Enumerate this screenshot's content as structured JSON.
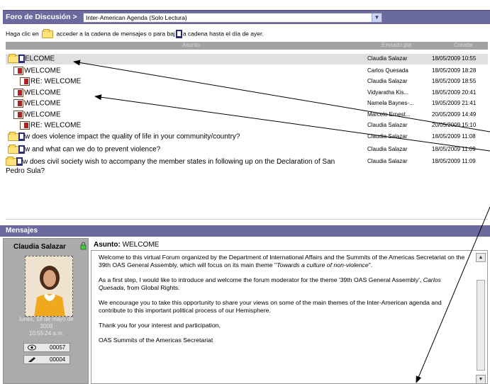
{
  "forum": {
    "title": "Foro de Discusión >",
    "selected_forum": "Inter-American Agenda (Solo Lectura)"
  },
  "instructions": {
    "part1": "Haga clic en",
    "part2": "acceder a la cadena de mensajes o para baj",
    "part3": "a cadena hasta el día de ayer."
  },
  "columns": {
    "subject": "Asunto",
    "sender": "Enviado por",
    "created": "Creada"
  },
  "threads": [
    {
      "subject": "ELCOME",
      "sender": "Claudia Salazar",
      "date": "18/05/2009 10:55"
    },
    {
      "subject": "WELCOME",
      "sender": "Carlos Quesada",
      "date": "18/05/2009 18:28"
    },
    {
      "subject": "RE: WELCOME",
      "sender": "Claudia Salazar",
      "date": "18/05/2009 18:55"
    },
    {
      "subject": "WELCOME",
      "sender": "Vidyaratha Kis...",
      "date": "18/05/2009 20:41"
    },
    {
      "subject": "WELCOME",
      "sender": "Namela Baynes-...",
      "date": "19/05/2009 21:41"
    },
    {
      "subject": "WELCOME",
      "sender": "Marcelo Ernest...",
      "date": "20/05/2009 14:49"
    },
    {
      "subject": "RE: WELCOME",
      "sender": "Claudia Salazar",
      "date": "20/05/2009 15:10"
    },
    {
      "subject": "w does violence impact the quality of life in your community/country?",
      "sender": "Claudia Salazar",
      "date": "18/05/2009 11:08"
    },
    {
      "subject": "w and what can we do to prevent violence?",
      "sender": "Claudia Salazar",
      "date": "18/05/2009 11:09"
    },
    {
      "subject": "w does civil society wish to accompany the member states in following up on the Declaration of San Pedro Sula?",
      "sender": "Claudia Salazar",
      "date": "18/05/2009 11:09"
    }
  ],
  "messages_panel": {
    "title": "Mensajes",
    "author": "Claudia Salazar",
    "author_date_line1": "lunes, 18 de mayo de",
    "author_date_line2": "2009",
    "author_time": "10:55:24 a.m.",
    "views": "00057",
    "posts": "00004",
    "subject_label": "Asunto:",
    "subject_value": "WELCOME",
    "body": {
      "p1": "Welcome to this virtual Forum organized by the Department of International Affairs and the Summits of the Americas Secretariat on the 39th OAS General Assembly, which will focus on its main theme \"",
      "p1_italic": "Towards a culture of non-violence",
      "p1_end": "\".",
      "p2": "As a first step, I would like to introduce and welcome the forum moderator for the theme '39th OAS General Assembly', ",
      "p2_italic": "Carlos Quesada",
      "p2_end": ", from Global Rights.",
      "p3": "We encourage you to take this opportunity to share your views on some of the main themes of the Inter-American agenda and contribute to this important political process of our Hemisphere.",
      "p4": "Thank you for your interest and participation,",
      "p5": "OAS Summits of the Americas Secretariat"
    }
  },
  "colors": {
    "header_bar": "#6b6a9f",
    "selected_row": "#e0e0e0",
    "author_panel": "#ababab"
  }
}
